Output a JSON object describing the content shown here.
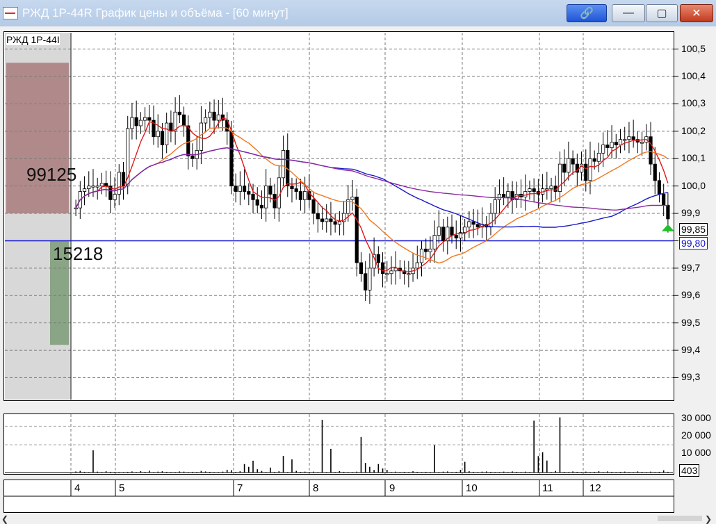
{
  "window": {
    "title": "РЖД 1Р-44R График цены и объёма - [60 минут]",
    "icon": "chart-window-icon",
    "buttons": [
      {
        "name": "link",
        "glyph": "🔗"
      },
      {
        "name": "minimize",
        "glyph": "—"
      },
      {
        "name": "maximize",
        "glyph": "▢"
      },
      {
        "name": "close",
        "glyph": "✕"
      }
    ]
  },
  "chart": {
    "instrument_label": "РЖД 1Р-44I",
    "order_book_ask_volume": "99125",
    "order_book_bid_volume": "15218",
    "price_axis_labels": [
      "100,5",
      "100,4",
      "100,3",
      "100,2",
      "100,1",
      "100,0",
      "99,9",
      "99,7",
      "99,6",
      "99,5",
      "99,4",
      "99,3"
    ],
    "last_price_tag": "99,85",
    "line_price_tag": "99,80",
    "volume_axis_labels": [
      "30 000",
      "20 000",
      "10 000"
    ],
    "last_volume_tag": "403",
    "date_labels": [
      "4",
      "5",
      "7",
      "8",
      "9",
      "10",
      "11",
      "12"
    ]
  },
  "chart_data": {
    "type": "candlestick",
    "ylim": [
      99.22,
      100.56
    ],
    "volume_ylim": [
      0,
      30000
    ],
    "horizontal_line": 99.8,
    "last_price": 99.85,
    "prices": [
      99.92,
      99.98,
      99.99,
      100.0,
      100.0,
      100.0,
      100.01,
      100.0,
      99.95,
      99.97,
      100.05,
      100.0,
      100.21,
      100.25,
      100.22,
      100.24,
      100.25,
      100.24,
      100.18,
      100.2,
      100.15,
      100.23,
      100.2,
      100.27,
      100.26,
      100.22,
      100.11,
      100.1,
      100.13,
      100.23,
      100.25,
      100.27,
      100.24,
      100.26,
      100.24,
      100.2,
      100.0,
      99.98,
      100.0,
      99.98,
      99.97,
      99.95,
      99.93,
      99.92,
      100.0,
      99.97,
      99.92,
      100.03,
      100.13,
      100.0,
      99.99,
      99.98,
      99.95,
      99.98,
      99.95,
      99.9,
      99.88,
      99.87,
      99.88,
      99.87,
      99.86,
      99.87,
      99.9,
      99.95,
      99.96,
      99.72,
      99.68,
      99.62,
      99.7,
      99.75,
      99.72,
      99.68,
      99.68,
      99.69,
      99.7,
      99.69,
      99.68,
      99.68,
      99.7,
      99.72,
      99.77,
      99.76,
      99.77,
      99.82,
      99.85,
      99.8,
      99.85,
      99.82,
      99.81,
      99.83,
      99.85,
      99.87,
      99.86,
      99.85,
      99.86,
      99.85,
      99.9,
      99.95,
      99.97,
      99.96,
      99.98,
      99.95,
      99.97,
      99.96,
      99.98,
      99.99,
      99.98,
      99.97,
      99.99,
      99.99,
      100.0,
      99.98,
      100.08,
      100.05,
      100.1,
      100.08,
      100.05,
      100.08,
      100.02,
      100.1,
      100.09,
      100.12,
      100.15,
      100.14,
      100.16,
      100.15,
      100.17,
      100.17,
      100.18,
      100.17,
      100.16,
      100.16,
      100.18,
      100.08,
      100.02,
      99.97,
      99.93,
      99.88
    ],
    "volumes": [
      600,
      900,
      400,
      300,
      12000,
      500,
      300,
      700,
      400,
      350,
      300,
      300,
      400,
      600,
      300,
      800,
      400,
      1000,
      300,
      500,
      700,
      400,
      300,
      300,
      600,
      500,
      300,
      400,
      350,
      900,
      600,
      400,
      300,
      300,
      500,
      1500,
      1300,
      400,
      700,
      4600,
      3100,
      6400,
      1800,
      900,
      300,
      2700,
      400,
      700,
      9000,
      300,
      7100,
      900,
      400,
      500,
      300,
      500,
      300,
      28500,
      300,
      12800,
      300,
      800,
      400,
      300,
      300,
      500,
      19200,
      5200,
      3100,
      1400,
      4600,
      2200,
      1500,
      300,
      500,
      300,
      400,
      300,
      700,
      400,
      300,
      400,
      300,
      14800,
      300,
      500,
      600,
      300,
      400,
      1500,
      5800,
      700,
      400,
      300,
      500,
      600,
      400,
      300,
      300,
      500,
      300,
      600,
      400,
      300,
      500,
      300,
      28000,
      8900,
      11000,
      6500,
      300,
      900,
      29800,
      400,
      300,
      600,
      400,
      300,
      500,
      300,
      400,
      700,
      300,
      600,
      400,
      300,
      400,
      500,
      300,
      300,
      600,
      400,
      300,
      500,
      300,
      400,
      1200,
      403
    ],
    "ma_series": [
      {
        "color": "#e01818",
        "window": 6
      },
      {
        "color": "#f07820",
        "window": 20
      },
      {
        "color": "#1818c8",
        "window": 60
      },
      {
        "color": "#8a2aa0",
        "window": 90
      }
    ],
    "order_book": {
      "ask_price_top": 100.45,
      "ask_price_bottom": 99.9,
      "bid_price_top": 99.8,
      "bid_price_bottom": 99.42
    }
  }
}
